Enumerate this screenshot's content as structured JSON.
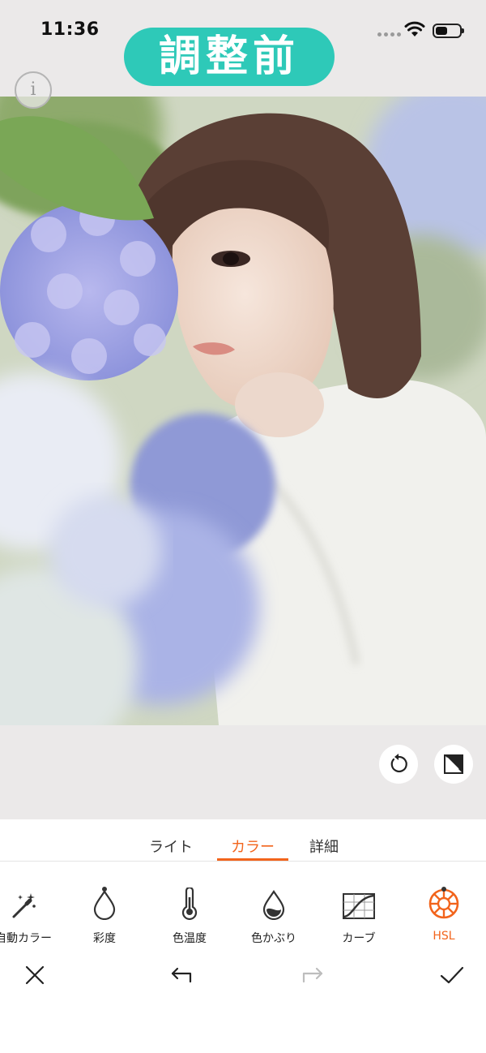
{
  "status_bar": {
    "time": "11:36"
  },
  "badge": {
    "text": "調整前"
  },
  "tabs": [
    {
      "label": "ライト",
      "active": false
    },
    {
      "label": "カラー",
      "active": true
    },
    {
      "label": "詳細",
      "active": false
    }
  ],
  "tools": [
    {
      "label": "自動カラー",
      "icon": "magic-wand-icon",
      "dot": false,
      "active": false
    },
    {
      "label": "彩度",
      "icon": "droplet-icon",
      "dot": true,
      "active": false
    },
    {
      "label": "色温度",
      "icon": "thermometer-icon",
      "dot": false,
      "active": false
    },
    {
      "label": "色かぶり",
      "icon": "tint-drop-icon",
      "dot": false,
      "active": false
    },
    {
      "label": "カーブ",
      "icon": "curve-icon",
      "dot": false,
      "active": false
    },
    {
      "label": "HSL",
      "icon": "color-wheel-icon",
      "dot": true,
      "active": true
    }
  ],
  "colors": {
    "accent": "#f2641c",
    "badge": "#2ec9b8",
    "background": "#ebe9e9"
  }
}
